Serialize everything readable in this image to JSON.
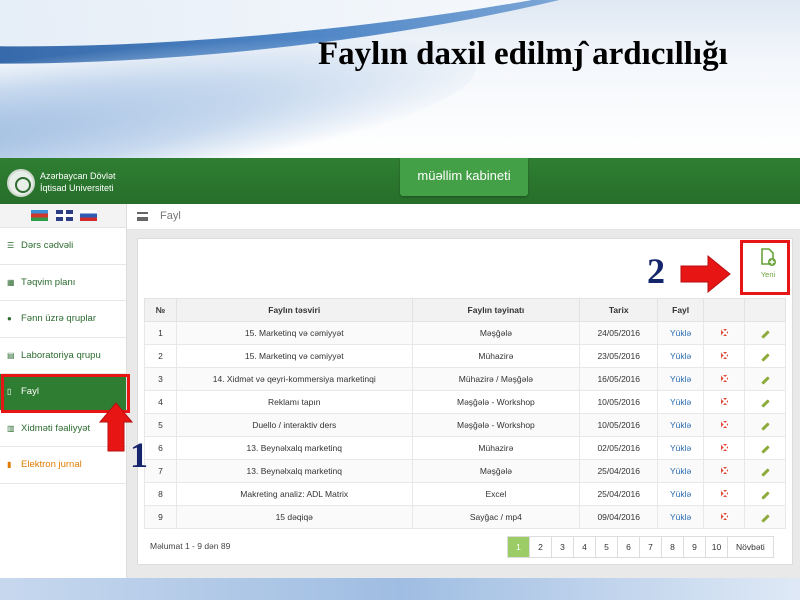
{
  "slide": {
    "title": "Faylın daxil edilmȷ̂  ardıcıllığı"
  },
  "header": {
    "university_line1": "Azərbaycan Dövlət",
    "university_line2": "İqtisad Universiteti",
    "cabinet_tab": "müəllim kabineti"
  },
  "breadcrumb": "Fayl",
  "sidebar": {
    "items": [
      {
        "label": "Dərs cədvəli",
        "icon": "list-icon"
      },
      {
        "label": "Təqvim planı",
        "icon": "calendar-icon"
      },
      {
        "label": "Fənn üzrə qruplar",
        "icon": "users-icon"
      },
      {
        "label": "Laboratoriya qrupu",
        "icon": "grid-icon"
      },
      {
        "label": "Fayl",
        "icon": "file-icon"
      },
      {
        "label": "Xidməti fəaliyyət",
        "icon": "chart-icon"
      },
      {
        "label": "Elektron jurnal",
        "icon": "book-icon"
      }
    ]
  },
  "new_button": {
    "label": "Yeni"
  },
  "table": {
    "headers": [
      "№",
      "Faylın təsviri",
      "Faylın təyinatı",
      "Tarix",
      "Fayl",
      "",
      ""
    ],
    "rows": [
      {
        "no": "1",
        "desc": "15. Marketinq və cəmiyyət",
        "type": "Məşğələ",
        "date": "24/05/2016",
        "file": "Yüklə"
      },
      {
        "no": "2",
        "desc": "15. Marketinq və cəmiyyət",
        "type": "Mühazirə",
        "date": "23/05/2016",
        "file": "Yüklə"
      },
      {
        "no": "3",
        "desc": "14. Xidmət və qeyri-kommersiya marketinqi",
        "type": "Mühazirə / Məşğələ",
        "date": "16/05/2016",
        "file": "Yüklə"
      },
      {
        "no": "4",
        "desc": "Reklamı tapın",
        "type": "Məşğələ - Workshop",
        "date": "10/05/2016",
        "file": "Yüklə"
      },
      {
        "no": "5",
        "desc": "Duello / interaktiv ders",
        "type": "Məşğələ - Workshop",
        "date": "10/05/2016",
        "file": "Yüklə"
      },
      {
        "no": "6",
        "desc": "13. Beynəlxalq marketinq",
        "type": "Mühazirə",
        "date": "02/05/2016",
        "file": "Yüklə"
      },
      {
        "no": "7",
        "desc": "13. Beynəlxalq marketinq",
        "type": "Məşğələ",
        "date": "25/04/2016",
        "file": "Yüklə"
      },
      {
        "no": "8",
        "desc": "Makreting analiz: ADL Matrix",
        "type": "Excel",
        "date": "25/04/2016",
        "file": "Yüklə"
      },
      {
        "no": "9",
        "desc": "15 dəqiqə",
        "type": "Sayğac / mp4",
        "date": "09/04/2016",
        "file": "Yüklə"
      }
    ]
  },
  "footer": {
    "info": "Məlumat 1 - 9 dən 89",
    "pages": [
      "1",
      "2",
      "3",
      "4",
      "5",
      "6",
      "7",
      "8",
      "9",
      "10",
      "Növbəti"
    ],
    "active_page": "1"
  },
  "annotations": {
    "step1": "1",
    "step2": "2"
  },
  "colors": {
    "primary_green": "#2e7d32",
    "annotation_red": "#e81515",
    "step_number": "#14256b"
  }
}
